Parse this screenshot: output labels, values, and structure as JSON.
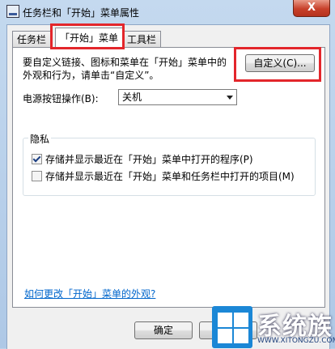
{
  "window": {
    "title": "任务栏和「开始」菜单属性",
    "close_glyph": "X"
  },
  "tabs": [
    {
      "label": "任务栏",
      "active": false
    },
    {
      "label": "「开始」菜单",
      "active": true
    },
    {
      "label": "工具栏",
      "active": false
    }
  ],
  "start_menu": {
    "description": "要自定义链接、图标和菜单在「开始」菜单中的外观和行为，请单击“自定义”。",
    "customize_button": "自定义(C)...",
    "power_label": "电源按钮操作(B):",
    "power_value": "关机",
    "privacy": {
      "title": "隐私",
      "options": [
        {
          "label": "存储并显示最近在「开始」菜单中打开的程序(P)",
          "checked": true
        },
        {
          "label": "存储并显示最近在「开始」菜单和任务栏中打开的项目(M)",
          "checked": false
        }
      ]
    },
    "help_link": "如何更改「开始」菜单的外观?"
  },
  "footer": {
    "ok_button": "确定"
  },
  "watermark": {
    "text": "系统族",
    "url": "WWW.XITONGZU.COM"
  },
  "annotation_color": "#e3262b"
}
